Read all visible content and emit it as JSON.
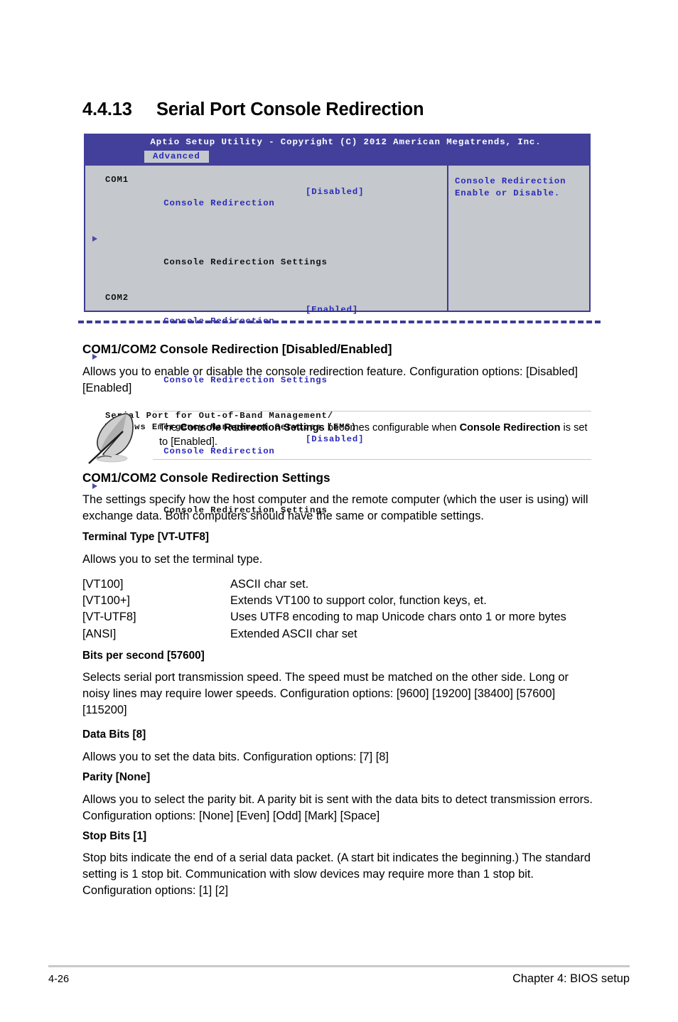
{
  "page": {
    "section_number": "4.4.13",
    "section_title": "Serial Port Console Redirection"
  },
  "bios": {
    "title": "Aptio Setup Utility - Copyright (C) 2012 American Megatrends, Inc.",
    "active_tab": "Advanced",
    "groups": [
      {
        "group_label": "COM1",
        "setting_label": "Console Redirection",
        "setting_value": "[Disabled]",
        "submenu_label": "Console Redirection Settings"
      },
      {
        "group_label": "COM2",
        "setting_label": "Console Redirection",
        "setting_value": "[Enabled]",
        "submenu_label": "Console Redirection Settings"
      }
    ],
    "ems_line1": "Serial Port for Out-of-Band Management/",
    "ems_line2": "Windows Emergency Management Services (EMS)",
    "ems_setting_label": "Console Redirection",
    "ems_setting_value": "[Disabled]",
    "ems_submenu_label": "Console Redirection Settings",
    "help_line1": "Console Redirection",
    "help_line2": "Enable or Disable.",
    "colors": {
      "header_bar": "#42409a",
      "panel_bg": "#c5c8cd",
      "border": "#3d3c93",
      "highlight_text": "#2a2ab8"
    }
  },
  "body": {
    "heading_1": "COM1/COM2 Console Redirection [Disabled/Enabled]",
    "para_1": "Allows you to enable or disable the console redirection feature. Configuration options: [Disabled] [Enabled]",
    "note": {
      "icon": "quill-pen-icon",
      "text_1": "The ",
      "bold_1": "Console Redirection Settings",
      "text_2": " becomes configurable when ",
      "bold_2": "Console Redirection",
      "text_3": " is set to [Enabled]."
    },
    "heading_2": "COM1/COM2 Console Redirection Settings",
    "para_2": "The settings specify how the host computer and the remote computer (which the user is using) will exchange data. Both computers should have the same or compatible settings.",
    "sub_heading_terminal": "Terminal Type [VT-UTF8]",
    "para_terminal": "Allows you to set the terminal type.",
    "terminal_options": [
      {
        "key": "[VT100]",
        "desc": "ASCII char set."
      },
      {
        "key": "[VT100+]",
        "desc": "Extends VT100 to support color, function keys, et."
      },
      {
        "key": "[VT-UTF8]",
        "desc": "Uses UTF8 encoding to map Unicode chars onto 1 or more bytes"
      },
      {
        "key": "[ANSI]",
        "desc": "Extended ASCII char set"
      }
    ],
    "sub_heading_bps": "Bits per second [57600]",
    "para_bps": "Selects serial port transmission speed. The speed must be matched on the other side. Long or noisy lines may require lower speeds. Configuration options: [9600] [19200] [38400] [57600] [115200]",
    "sub_heading_databits": "Data Bits [8]",
    "para_databits": "Allows you to set the data bits. Configuration options: [7] [8]",
    "sub_heading_parity": "Parity [None]",
    "para_parity": "Allows you to select the parity bit. A parity bit is sent with the data bits to detect transmission errors. Configuration options: [None] [Even] [Odd] [Mark] [Space]",
    "sub_heading_stopbits": "Stop Bits [1]",
    "para_stopbits": "Stop bits indicate the end of a serial data packet. (A start bit indicates the beginning.) The standard setting is 1 stop bit. Communication with slow devices may require more than 1 stop bit. Configuration options: [1] [2]"
  },
  "footer": {
    "page_number": "4-26",
    "chapter": "Chapter 4: BIOS setup"
  }
}
